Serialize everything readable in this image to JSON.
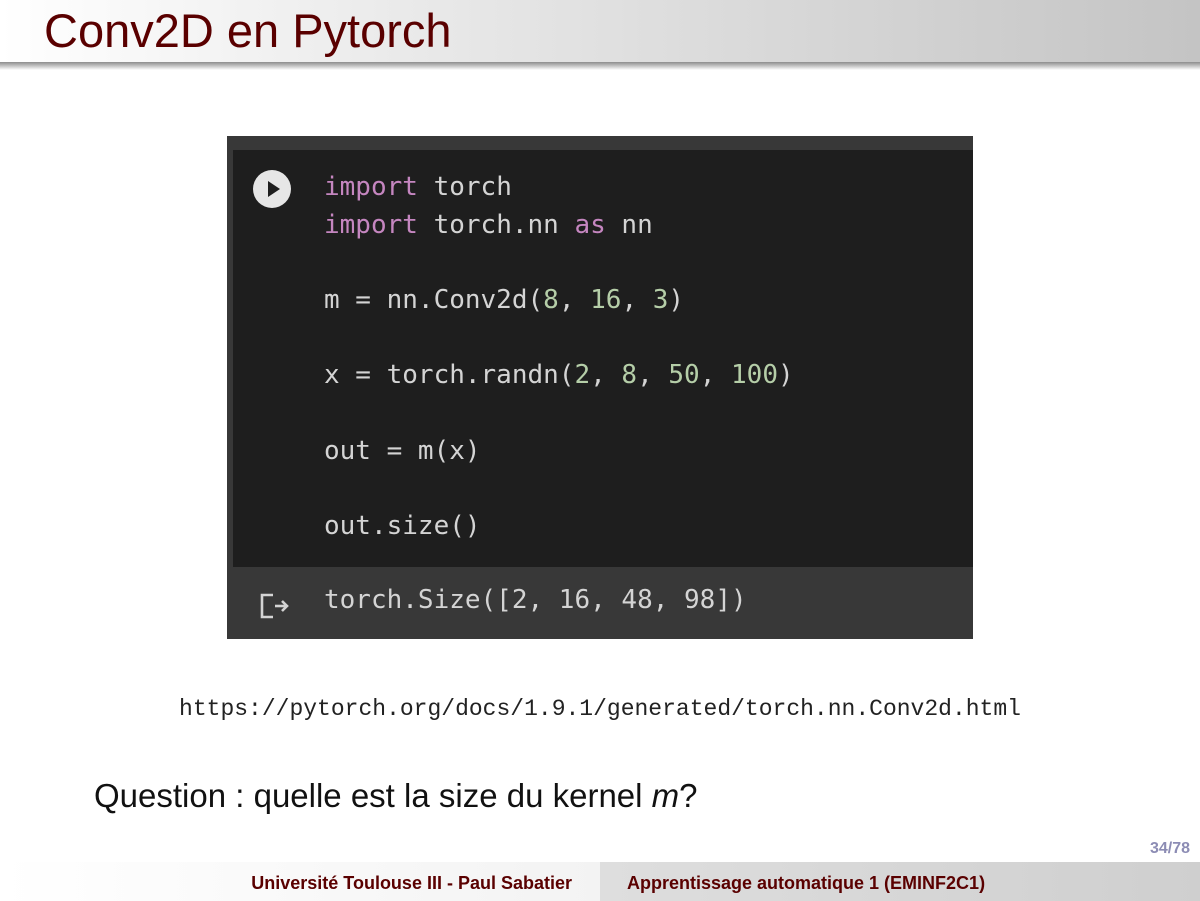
{
  "slide": {
    "title": "Conv2D en Pytorch",
    "page_number": "34/78"
  },
  "code_cell": {
    "lines": [
      {
        "parts": [
          {
            "t": "import",
            "c": "kw"
          },
          {
            "t": " torch",
            "c": ""
          }
        ]
      },
      {
        "parts": [
          {
            "t": "import",
            "c": "kw"
          },
          {
            "t": " torch.nn ",
            "c": ""
          },
          {
            "t": "as",
            "c": "kw"
          },
          {
            "t": " nn",
            "c": ""
          }
        ]
      },
      {
        "parts": []
      },
      {
        "parts": [
          {
            "t": "m = nn.Conv2d(",
            "c": ""
          },
          {
            "t": "8",
            "c": "num"
          },
          {
            "t": ", ",
            "c": ""
          },
          {
            "t": "16",
            "c": "num"
          },
          {
            "t": ", ",
            "c": ""
          },
          {
            "t": "3",
            "c": "num"
          },
          {
            "t": ")",
            "c": ""
          }
        ]
      },
      {
        "parts": []
      },
      {
        "parts": [
          {
            "t": "x = torch.randn(",
            "c": ""
          },
          {
            "t": "2",
            "c": "num"
          },
          {
            "t": ", ",
            "c": ""
          },
          {
            "t": "8",
            "c": "num"
          },
          {
            "t": ", ",
            "c": ""
          },
          {
            "t": "50",
            "c": "num"
          },
          {
            "t": ", ",
            "c": ""
          },
          {
            "t": "100",
            "c": "num"
          },
          {
            "t": ")",
            "c": ""
          }
        ]
      },
      {
        "parts": []
      },
      {
        "parts": [
          {
            "t": "out = m(x)",
            "c": ""
          }
        ]
      },
      {
        "parts": []
      },
      {
        "parts": [
          {
            "t": "out.size()",
            "c": ""
          }
        ]
      }
    ],
    "output": "torch.Size([2, 16, 48, 98])",
    "icons": {
      "run": "play-circle-icon",
      "output": "output-arrow-icon"
    }
  },
  "reference_url": "https://pytorch.org/docs/1.9.1/generated/torch.nn.Conv2d.html",
  "question": {
    "text": "Question : quelle est la size du kernel ",
    "var": "m",
    "end": "?"
  },
  "footer": {
    "left": "Université Toulouse III - Paul Sabatier",
    "right": "Apprentissage automatique 1 (EMINF2C1)"
  },
  "colors": {
    "title": "#5a0000",
    "keyword": "#c586c0",
    "number": "#b5cea8",
    "code_text": "#d4d4d4",
    "code_background": "#1e1e1e",
    "page_number": "#8c8cb4"
  }
}
